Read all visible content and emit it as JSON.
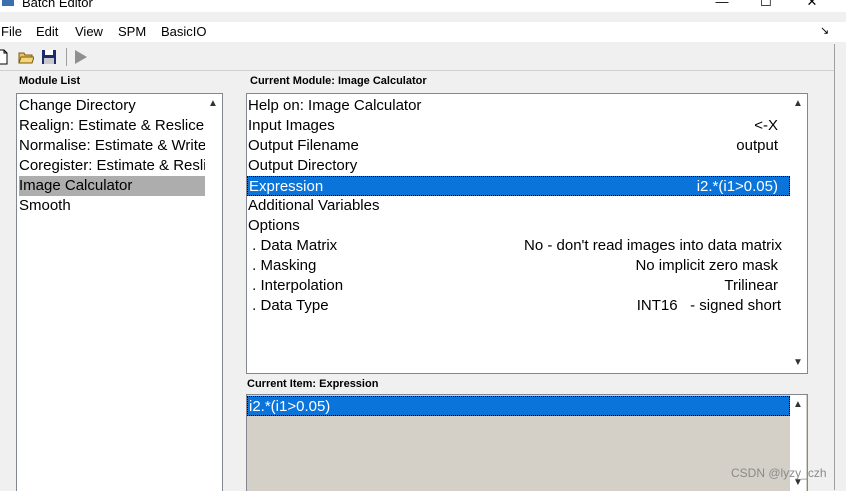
{
  "window": {
    "title": "Batch Editor",
    "minimize_glyph": "—",
    "maximize_glyph": "☐",
    "close_glyph": "✕"
  },
  "menu": [
    "File",
    "Edit",
    "View",
    "SPM",
    "BasicIO"
  ],
  "dock_glyph": "↘",
  "toolbar": {
    "icons": [
      "new-file-icon",
      "open-folder-icon",
      "save-icon",
      "run-icon"
    ]
  },
  "module_list": {
    "title": "Module List",
    "items": [
      "Change Directory",
      "Realign: Estimate & Reslice",
      "Normalise: Estimate & Write",
      "Coregister: Estimate & Reslice",
      "Image Calculator",
      "Smooth"
    ],
    "selected_index": 4
  },
  "current_module": {
    "title": "Current Module: Image Calculator",
    "rows": [
      {
        "label": "Help on: Image Calculator",
        "value": ""
      },
      {
        "label": "Input Images",
        "value": "<-X"
      },
      {
        "label": "Output Filename",
        "value": "output"
      },
      {
        "label": "Output Directory",
        "value": ""
      },
      {
        "label": "Expression",
        "value": "i2.*(i1>0.05)"
      },
      {
        "label": "Additional Variables",
        "value": ""
      },
      {
        "label": "Options",
        "value": ""
      },
      {
        "label": " . Data Matrix",
        "value": "No - don't read images into data matrix"
      },
      {
        "label": " . Masking",
        "value": "No implicit zero mask"
      },
      {
        "label": " . Interpolation",
        "value": "Trilinear"
      },
      {
        "label": " . Data Type",
        "value": "INT16   - signed short"
      }
    ],
    "selected_index": 4
  },
  "current_item": {
    "title": "Current Item: Expression",
    "value": "i2.*(i1>0.05)"
  },
  "scroll": {
    "up": "▲",
    "down": "▼"
  },
  "watermark": "CSDN @lyzy_czh",
  "colors": {
    "selection": "#0a74da",
    "module_selected": "#adadad",
    "item_area": "#d4d0c8"
  }
}
